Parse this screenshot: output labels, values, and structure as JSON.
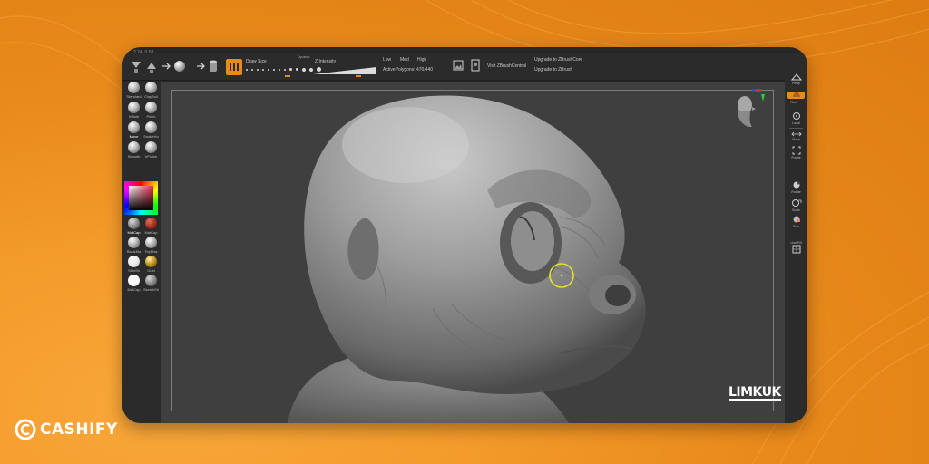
{
  "brand": {
    "name": "CASHIFY",
    "color": "#ffffff",
    "background": "#e98a1c"
  },
  "app": {
    "title_info": "2.24, 0.58",
    "accent_color": "#e98a1c"
  },
  "toolbar": {
    "draw_mode_icon": "draw-brush-icon",
    "draw_size_label": "Draw Size",
    "dynamic_label": "Dynamic",
    "z_intensity_label": "Z Intensity",
    "quality_low": "Low",
    "quality_med": "Med",
    "quality_high": "High",
    "active_polygons": "ActivePolygons: 470,440",
    "visit_link": "Visit ZBrushCentral",
    "upgrade_core": "Upgrade to ZBrushCore",
    "upgrade_zbrush": "Upgrade to ZBrush"
  },
  "left_panel": {
    "brushes": [
      {
        "label": "Standard",
        "icon": "standard-brush-icon"
      },
      {
        "label": "ClayBuil",
        "icon": "claybuildup-brush-icon"
      },
      {
        "label": "Inflate",
        "icon": "inflate-brush-icon"
      },
      {
        "label": "Pinch",
        "icon": "pinch-brush-icon"
      },
      {
        "label": "Move",
        "icon": "move-brush-icon"
      },
      {
        "label": "SnakeHo",
        "icon": "snakehook-brush-icon"
      },
      {
        "label": "Smooth",
        "icon": "smooth-brush-icon"
      },
      {
        "label": "hPolish",
        "icon": "hpolish-brush-icon"
      }
    ],
    "materials": [
      {
        "label": "MatCap",
        "color": "#9a9a9a"
      },
      {
        "label": "MatCap",
        "color": "#b23a2a"
      },
      {
        "label": "BasicMa",
        "color": "#c4c4c4"
      },
      {
        "label": "ToyPlas",
        "color": "#d0d0d0"
      },
      {
        "label": "SkinSh",
        "color": "#d8d8d8"
      },
      {
        "label": "Gold",
        "color": "#c79a2a"
      },
      {
        "label": "MatCap",
        "color": "#f2f2f2"
      },
      {
        "label": "SketchSh",
        "color": "#9c9c9c"
      }
    ]
  },
  "right_panel": {
    "items": [
      {
        "label": "Persp",
        "icon": "perspective-icon"
      },
      {
        "label": "Floor",
        "icon": "floor-grid-icon"
      },
      {
        "label": "Local",
        "icon": "local-symmetry-icon"
      },
      {
        "label": "Move",
        "icon": "move-view-icon"
      },
      {
        "label": "Frame",
        "icon": "frame-view-icon"
      },
      {
        "label": "Rotate",
        "icon": "rotate-view-icon"
      },
      {
        "label": "Scale",
        "icon": "scale-view-icon"
      },
      {
        "label": "Solo",
        "icon": "solo-icon"
      },
      {
        "label": "Line Fill",
        "icon": "line-fill-icon"
      }
    ]
  },
  "canvas": {
    "model": "alien-head-sculpt",
    "nav_widget": "navigation-head-icon",
    "watermark": "LIMKUK"
  }
}
